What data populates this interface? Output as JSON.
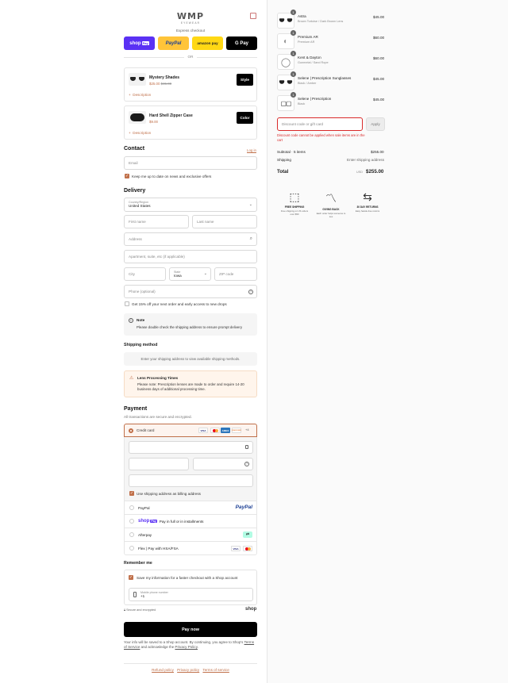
{
  "brand": {
    "mark": "WMP",
    "sub": "EYEWEAR"
  },
  "express": {
    "label": "Express checkout",
    "shoppay": "shop",
    "shoppay_badge": "Pay",
    "paypal": "PayPal",
    "amazon": "amazon pay",
    "gpay": "G Pay",
    "or": "OR"
  },
  "upsells": [
    {
      "name": "Mystery Shades",
      "price": "$25.00",
      "old_price": "$45.00",
      "button": "Style",
      "link": "Description"
    },
    {
      "name": "Hard Shell Zipper Case",
      "price": "$9.00",
      "button": "Color",
      "link": "Description"
    }
  ],
  "contact": {
    "title": "Contact",
    "login": "Log in",
    "email_placeholder": "Email",
    "news_label": "Keep me up to date on news and exclusive offers"
  },
  "delivery": {
    "title": "Delivery",
    "country_label": "Country/Region",
    "country_value": "United States",
    "first_name": "First name",
    "last_name": "Last name",
    "address": "Address",
    "apartment": "Apartment, suite, etc (if applicable)",
    "city": "City",
    "state_label": "State",
    "state_value": "Iowa",
    "zip": "ZIP code",
    "phone": "Phone (optional)",
    "promo_label": "Get 15% off your next order and early access to new drops",
    "note_title": "Note",
    "note_text": "Please double check the shipping address to ensure prompt delivery"
  },
  "shipping": {
    "title": "Shipping method",
    "placeholder": "Enter your shipping address to view available shipping methods.",
    "warn_title": "Lens Processing Times",
    "warn_text": "Please note: Prescription lenses are made to order and require 14-20 business days of additional processing time."
  },
  "payment": {
    "title": "Payment",
    "subtitle": "All transactions are secure and encrypted.",
    "credit_card": "Credit card",
    "card_badges": [
      "VISA",
      "MC",
      "AMEX",
      "DISCOVER"
    ],
    "more_badge": "+4",
    "billing_label": "Use shipping address as billing address",
    "paypal": "PayPal",
    "paypal_logo": "PayPal",
    "shoppay": "shop",
    "shoppay_badge": "Pay",
    "shoppay_text": "Pay in full or in installments",
    "afterpay": "Afterpay",
    "flex": "Flex | Pay with HSA/FSA"
  },
  "remember": {
    "title": "Remember me",
    "save_label": "Save my information for a faster checkout with a Shop account",
    "phone_label": "Mobile phone number",
    "phone_value": "+1",
    "secure": "Secure and encrypted",
    "shop_logo": "shop"
  },
  "pay_now": "Pay now",
  "legal": {
    "text1": "Your info will be saved to a Shop account. By continuing, you agree to Shop's",
    "terms": "Terms of Service",
    "and": "and acknowledge the",
    "privacy": "Privacy Policy",
    "dot": "."
  },
  "footer": {
    "refund": "Refund policy",
    "privacy": "Privacy policy",
    "terms": "Terms of service"
  },
  "cart": {
    "items": [
      {
        "qty": "1",
        "name": "Astra",
        "variant": "Brown Tortoise / Dark Brown Lens",
        "price": "$45.00"
      },
      {
        "qty": "1",
        "name": "Premium AR",
        "variant": "Premium AR",
        "price": "$60.00"
      },
      {
        "qty": "1",
        "name": "Kent & Dayton",
        "variant": "Gunmetal / Sand Rope",
        "price": "$60.00"
      },
      {
        "qty": "1",
        "name": "Selene | Prescription Sunglasses",
        "variant": "Black / Amber",
        "price": "$45.00"
      },
      {
        "qty": "1",
        "name": "Selene | Prescription",
        "variant": "Black",
        "price": "$45.00"
      }
    ],
    "discount_placeholder": "Discount code or gift card",
    "apply": "Apply",
    "discount_error": "Discount code cannot be applied when sale items are in the cart",
    "subtotal_label": "Subtotal · 5 items",
    "subtotal_value": "$255.00",
    "shipping_label": "Shipping",
    "shipping_value": "Enter shipping address",
    "total_label": "Total",
    "currency": "USD",
    "total_value": "$255.00"
  },
  "trust": [
    {
      "icon": "box-icon",
      "title": "FREE SHIPPING",
      "desc": "Free shipping on US orders over $50"
    },
    {
      "icon": "glasses-icon",
      "title": "GIVING BACK",
      "desc": "Each order helps someone to see"
    },
    {
      "icon": "return-icon",
      "title": "30 DAY RETURNS",
      "desc": "Easy hassle-free returns"
    }
  ],
  "colors": {
    "accent": "#c0704a",
    "shoppay": "#5a31f4",
    "paypal": "#ffc439",
    "amazon": "#ffd814",
    "error": "#d92a2a"
  }
}
